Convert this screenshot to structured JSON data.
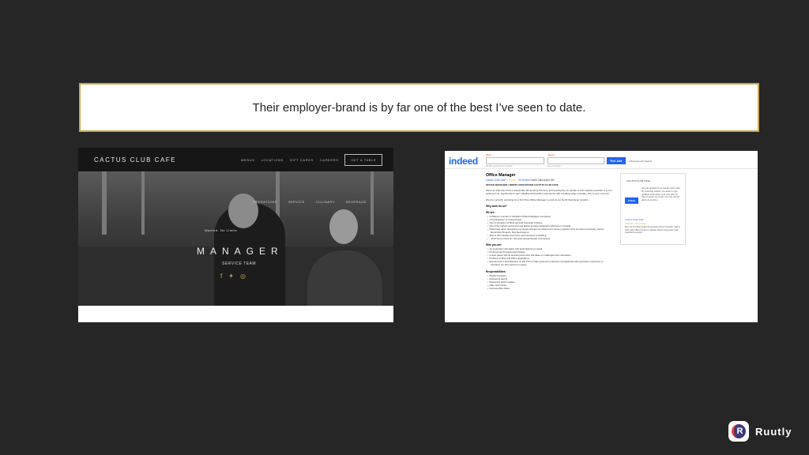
{
  "quote": {
    "text": "Their employer-brand is by far one of the best I’ve seen to date."
  },
  "left_screenshot": {
    "logo": "CACTUS CLUB CAFE",
    "nav": [
      "MENUS",
      "LOCATIONS",
      "GIFT CARDS",
      "CAREERS"
    ],
    "cta": "GET A TABLE",
    "subnav": [
      "OPERATIONS",
      "SERVICE",
      "CULINARY",
      "BEVERAGE"
    ],
    "hero_tagline": "Wanted: No Limits",
    "hero_title": "MANAGER",
    "hero_subtitle": "SERVICE TEAM",
    "social_icons": [
      "facebook-icon",
      "twitter-icon",
      "instagram-icon"
    ]
  },
  "right_screenshot": {
    "logo": "indeed",
    "what_label": "what",
    "where_label": "where",
    "what_hint": "job title, keywords or company",
    "where_hint": "city or province",
    "find_button": "Find Jobs",
    "advanced_link": "Advanced Job Search",
    "job_title": "Office Manager",
    "company": "Cactus Club Cafe",
    "stars": "★★★★☆",
    "reviews": "92 reviews",
    "location": "North Vancouver, BC",
    "headline": "OFFICE MANAGER | NORTH VANCOUVER CACTUS CLUB CAFE",
    "intro": "We're an elite team that is passionate about hiring the best, and developing our people to their highest potential. If you're looking for an opportunity to gain valuable admin/office experience with a leading edge company, this is your moment!",
    "recruiting": "We are currently recruiting for a Full Time Office Manager to work at our North Vancouver location.",
    "why_heading": "Why work for us?",
    "we_are_heading": "We are:",
    "we_are": [
      "A Platinum member of Canada's 50 Best Managed Companies",
      "A Top Employer of Young People",
      "One of Canada's 10 Most Admired Corporate Cultures",
      "One of the highest performing and fastest growing restaurant collectives in Canada",
      "Passionate about developing our people through our advanced in house programs such as Cactus University, Cactus Mentorship Program, Red Seal support",
      "Able to offer flexible work hours and consistent scheduling",
      "...FUN! Get to know us: visit www.cactusclubcafe.com/careers"
    ],
    "who_heading": "Who you are:",
    "who": [
      "An organized multi-tasker with great attention to detail",
      "Professional, Principled and Positive",
      "A team player with an amazing work ethic that takes on challenges with enthusiasm",
      "Proficient in Microsoft Office applications",
      "Experienced in administration or with Point of Sale systems is preferred, but applicants with equivalent experience or education are also welcome to apply."
    ],
    "resp_heading": "Responsibilities:",
    "resp": [
      "Weekly Numbers",
      "Restaurant payroll",
      "Restaurant batch headers",
      "Daily cash routine",
      "General office duties"
    ],
    "card_company": "CACTUS CLUB CAFE",
    "follow_button": "Follow",
    "card_text": "Get job updates from Cactus Club Cafe. By selecting Follow, you agree to get updated information and new jobs for this company by email. You can cancel alerts at anytime.",
    "card_name": "Cactus Club Cafe",
    "card_reviews": "★★★★☆ 92 reviews",
    "card_desc": "Born on the West Coast and growing across Canada, Cactus Club Cafe offers the best in global cuisine using local, fresh ingredients served..."
  },
  "brand": {
    "name": "Ruutly",
    "icon": "ruutly-logo-icon",
    "accent": "#e5413f",
    "primary": "#3d3a7a"
  },
  "colors": {
    "background": "#262626",
    "frame_gold": "#c9a74e",
    "indeed_blue": "#2164f3"
  }
}
